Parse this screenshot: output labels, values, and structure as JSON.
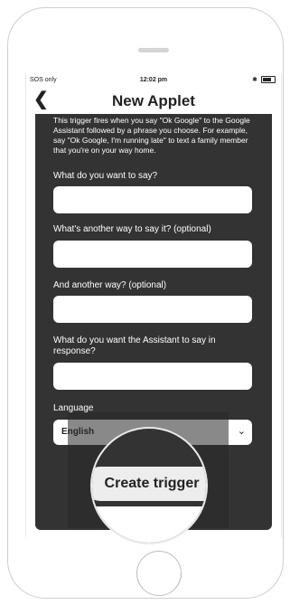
{
  "status": {
    "carrier": "SOS only",
    "time": "12:02 pm"
  },
  "nav": {
    "title": "New Applet",
    "back_icon": "chevron-left-icon"
  },
  "trigger": {
    "description": "This trigger fires when you say \"Ok Google\" to the Google Assistant followed by a phrase you choose. For example, say \"Ok Google, I'm running late\" to text a family member that you're on your way home.",
    "fields": [
      {
        "label": "What do you want to say?",
        "value": ""
      },
      {
        "label": "What's another way to say it? (optional)",
        "value": ""
      },
      {
        "label": "And another way? (optional)",
        "value": ""
      },
      {
        "label": "What do you want the Assistant to say in response?",
        "value": ""
      }
    ],
    "language_label": "Language",
    "language_value": "English",
    "create_button": "Create trigger"
  }
}
